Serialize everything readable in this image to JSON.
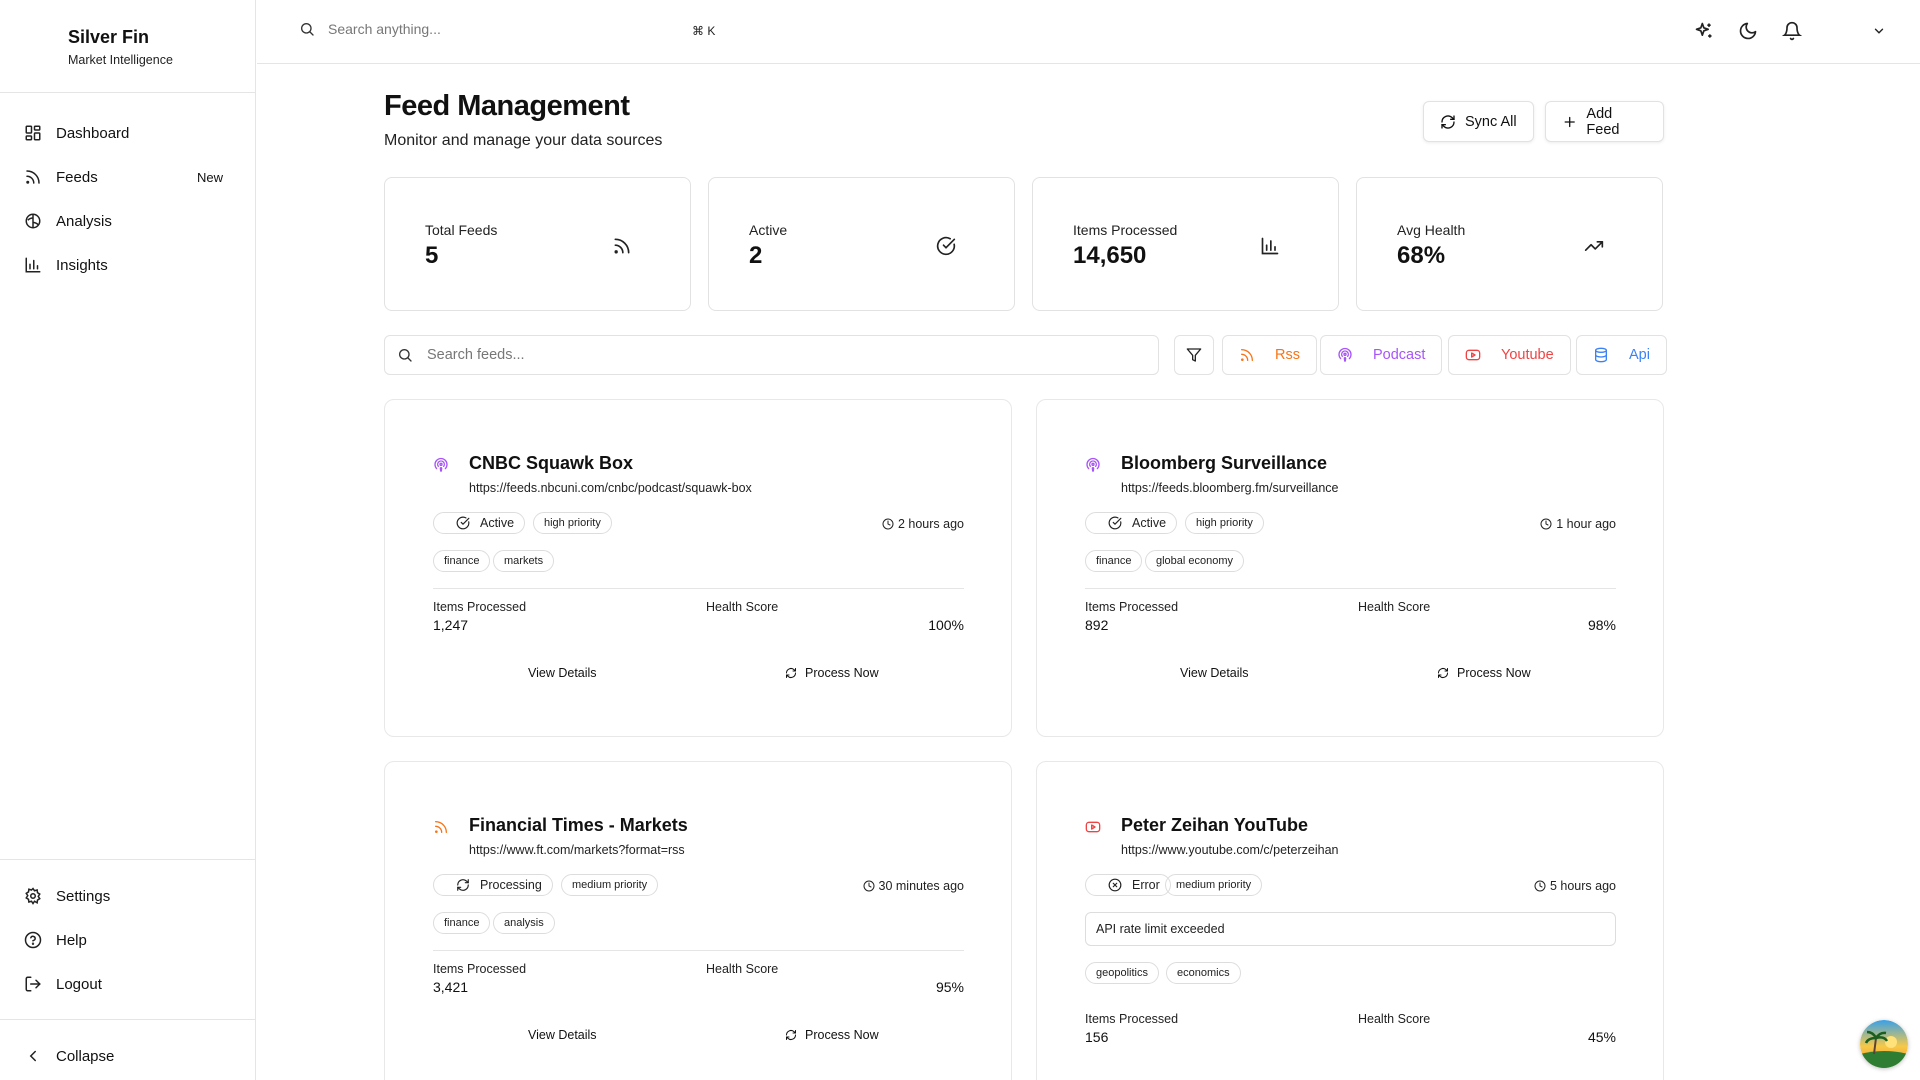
{
  "app": {
    "name": "Silver Fin",
    "subtitle": "Market Intelligence"
  },
  "sidebar": {
    "items": [
      {
        "label": "Dashboard",
        "icon": "dashboard-icon"
      },
      {
        "label": "Feeds",
        "icon": "rss-icon",
        "badge": "New"
      },
      {
        "label": "Analysis",
        "icon": "brain-icon"
      },
      {
        "label": "Insights",
        "icon": "bar-chart-icon"
      }
    ],
    "bottom": [
      {
        "label": "Settings",
        "icon": "gear-icon"
      },
      {
        "label": "Help",
        "icon": "help-circle-icon"
      },
      {
        "label": "Logout",
        "icon": "logout-icon"
      }
    ],
    "collapse": "Collapse"
  },
  "topbar": {
    "search_placeholder": "Search anything...",
    "shortcut": "⌘ K"
  },
  "header": {
    "title": "Feed Management",
    "subtitle": "Monitor and manage your data sources",
    "sync_label": "Sync All",
    "add_label": "Add Feed"
  },
  "stats": [
    {
      "label": "Total Feeds",
      "value": "5",
      "icon": "rss-icon"
    },
    {
      "label": "Active",
      "value": "2",
      "icon": "check-circle-icon"
    },
    {
      "label": "Items Processed",
      "value": "14,650",
      "icon": "bar-chart-icon"
    },
    {
      "label": "Avg Health",
      "value": "68%",
      "icon": "trending-up-icon"
    }
  ],
  "filters": {
    "search_placeholder": "Search feeds...",
    "types": [
      {
        "label": "Rss",
        "color": "#f97316",
        "icon": "rss-icon"
      },
      {
        "label": "Podcast",
        "color": "#a855f7",
        "icon": "podcast-icon"
      },
      {
        "label": "Youtube",
        "color": "#ef4444",
        "icon": "youtube-icon"
      },
      {
        "label": "Api",
        "color": "#3b82f6",
        "icon": "database-icon"
      }
    ]
  },
  "feeds": [
    {
      "title": "CNBC Squawk Box",
      "url": "https://feeds.nbcuni.com/cnbc/podcast/squawk-box",
      "type": "podcast",
      "status": "Active",
      "priority": "high priority",
      "time": "2 hours ago",
      "tags": [
        "finance",
        "markets"
      ],
      "items_label": "Items Processed",
      "items": "1,247",
      "health_label": "Health Score",
      "health": "100%",
      "view_label": "View Details",
      "process_label": "Process Now"
    },
    {
      "title": "Bloomberg Surveillance",
      "url": "https://feeds.bloomberg.fm/surveillance",
      "type": "podcast",
      "status": "Active",
      "priority": "high priority",
      "time": "1 hour ago",
      "tags": [
        "finance",
        "global economy"
      ],
      "items_label": "Items Processed",
      "items": "892",
      "health_label": "Health Score",
      "health": "98%",
      "view_label": "View Details",
      "process_label": "Process Now"
    },
    {
      "title": "Financial Times - Markets",
      "url": "https://www.ft.com/markets?format=rss",
      "type": "rss",
      "status": "Processing",
      "priority": "medium priority",
      "time": "30 minutes ago",
      "tags": [
        "finance",
        "analysis"
      ],
      "items_label": "Items Processed",
      "items": "3,421",
      "health_label": "Health Score",
      "health": "95%",
      "view_label": "View Details",
      "process_label": "Process Now"
    },
    {
      "title": "Peter Zeihan YouTube",
      "url": "https://www.youtube.com/c/peterzeihan",
      "type": "youtube",
      "status": "Error",
      "priority": "medium priority",
      "time": "5 hours ago",
      "error": "API rate limit exceeded",
      "tags": [
        "geopolitics",
        "economics"
      ],
      "items_label": "Items Processed",
      "items": "156",
      "health_label": "Health Score",
      "health": "45%"
    }
  ],
  "colors": {
    "rss": "#f97316",
    "podcast": "#a855f7",
    "youtube": "#ef4444",
    "api": "#3b82f6"
  }
}
